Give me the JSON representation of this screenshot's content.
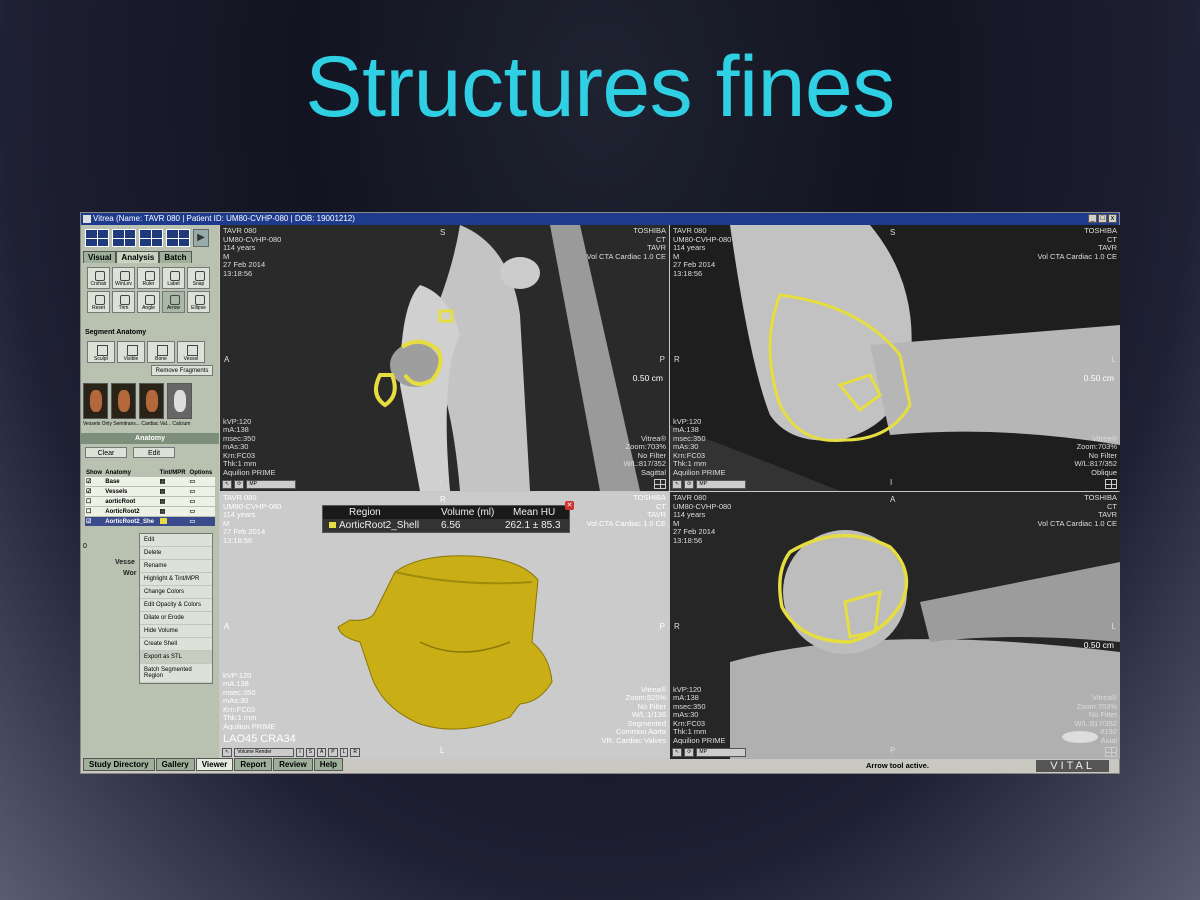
{
  "slide": {
    "title": "Structures fines"
  },
  "window": {
    "title": "Vitrea (Name: TAVR 080 | Patient ID: UM80-CVHP-080 | DOB: 19001212)",
    "controls": [
      "_",
      "□",
      "x"
    ]
  },
  "left_panel": {
    "tabs": [
      "Visual",
      "Analysis",
      "Batch"
    ],
    "active_tab": "Analysis",
    "tools": [
      "Crshair",
      "WinLev",
      "Ruler",
      "Label",
      "Snap",
      "Reset",
      "Trim",
      "Angle",
      "Arrow",
      "Ellipse"
    ],
    "segment_label": "Segment Anatomy",
    "segment_tools": [
      "Sculpt",
      "Visible",
      "Bone",
      "Vessel"
    ],
    "remove_fragments": "Remove Fragments",
    "presets_caption": "Vessels Only Semitrans... Cardiac Val... Calcium",
    "anatomy_title": "Anatomy",
    "clear": "Clear",
    "edit": "Edit",
    "table_headers": [
      "Show",
      "Anatomy",
      "Tint/MPR",
      "Options"
    ],
    "rows": [
      "Base",
      "Vessels",
      "aorticRoot",
      "AorticRoot2",
      "AorticRoot2_She"
    ],
    "zero": "0",
    "vessel_lbl": "Vesse",
    "work_lbl": "Wor",
    "context_menu": [
      "Edit",
      "Delete",
      "Rename",
      "Highlight & Tint/MPR",
      "Change Colors",
      "Edit Opacity & Colors",
      "Dilate or Erode",
      "Hide Volume",
      "Create Shell",
      "Export as STL",
      "Batch Segmented Region"
    ],
    "context_highlight": "Export as STL"
  },
  "viewports": {
    "v1": {
      "tl": "TAVR 080\nUM80-CVHP-080\n114 years\nM\n27 Feb 2014\n13:18:56",
      "tr": "TOSHIBA\nCT\nTAVR\nVol CTA Cardiac 1.0 CE",
      "bl": "kVP:120\nmA:138\nmsec:350\nmAs:30\nKrn:FC03\nThk:1 mm\nAquilion PRIME",
      "br": "Vitrea®\nZoom:703%\nNo Filter\nW/L:817/352\nSagittal",
      "top": "S",
      "left": "A",
      "right": "P",
      "bottom": "I",
      "scale": "0.50 cm"
    },
    "v2": {
      "tl": "TAVR 080\nUM80-CVHP-080\n114 years\nM\n27 Feb 2014\n13:18:56",
      "tr": "TOSHIBA\nCT\nTAVR\nVol CTA Cardiac 1.0 CE",
      "bl": "kVP:120\nmA:138\nmsec:350\nmAs:30\nKrn:FC03\nThk:1 mm\nAquilion PRIME",
      "br": "Vitrea®\nZoom:703%\nNo Filter\nW/L:817/352\nOblique",
      "top": "S",
      "left": "R",
      "right": "L",
      "bottom": "I",
      "scale": "0.50 cm"
    },
    "v3": {
      "tl": "TAVR 080\nUM80-CVHP-080\n114 years\nM\n27 Feb 2014\n13:18:56",
      "tr": "TOSHIBA\nCT\nTAVR\nVol CTA Cardiac 1.0 CE",
      "bl": "kVP:120\nmA:138\nmsec:350\nmAs:30\nKrn:FC03\nThk:1 mm\nAquilion PRIME",
      "br": "Vitrea®\nZoom:825%\nNo Filter\nW/L:1/136\nSegmented\nCommon Aorta\nVR: Cardiac Valves",
      "angle": "LAO45 CRA34",
      "top": "R",
      "left": "A",
      "right": "P",
      "bottom": "L",
      "mode": "Volume Render",
      "region_headers": [
        "Region",
        "Volume (ml)",
        "Mean HU"
      ],
      "region_name": "AorticRoot2_Shell",
      "region_volume": "6.56",
      "region_hu": "262.1 ± 85.3"
    },
    "v4": {
      "tl": "TAVR 080\nUM80-CVHP-080\n114 years\nM\n27 Feb 2014\n13:18:56",
      "tr": "TOSHIBA\nCT\nTAVR\nVol CTA Cardiac 1.0 CE",
      "bl": "kVP:120\nmA:138\nmsec:350\nmAs:30\nKrn:FC03\nThk:1 mm\nAquilion PRIME",
      "br": "Vitrea®\nZoom:703%\nNo Filter\nW/L:817/352\n#192\nAxial",
      "top": "A",
      "left": "R",
      "right": "L",
      "bottom": "P",
      "scale": "0.50 cm"
    }
  },
  "bottom_tabs": [
    "Study Directory",
    "Gallery",
    "Viewer",
    "Report",
    "Review",
    "Help"
  ],
  "active_bottom_tab": "Viewer",
  "status": "Arrow tool active.",
  "brand": "VITAL",
  "colors": {
    "title": "#2fd0e4",
    "segmentation": "#e6dd40",
    "titlebar": "#1e3a8c"
  }
}
